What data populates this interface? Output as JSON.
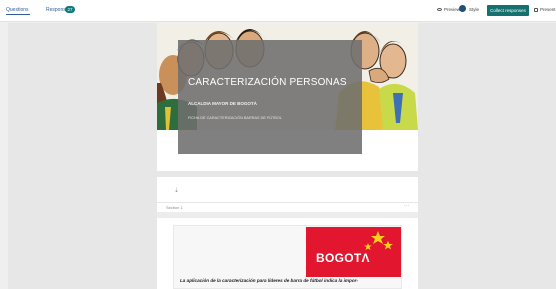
{
  "tabs": {
    "questions": "Questions",
    "responses": "Responses",
    "responses_count": "27"
  },
  "toolbar": {
    "preview": "Preview",
    "style": "Style",
    "collect": "Collect responses",
    "present": "Present"
  },
  "form": {
    "title": "CARACTERIZACIÓN PERSONAS",
    "org": "ALCALDIA MAYOR DE BOGOTÁ",
    "desc": "FICHA DE CARACTERIZACIÓN BARRAS DE FÚTBOL"
  },
  "section": {
    "label": "Section 1",
    "more": "···",
    "logo_text": "BOGOTΛ",
    "intro_text": "La aplicación de la caracterización para líderes de barra de fútbol indica la impor-"
  },
  "colors": {
    "accent": "#15706f",
    "link": "#2f5f96",
    "logo_red": "#e2162e"
  }
}
